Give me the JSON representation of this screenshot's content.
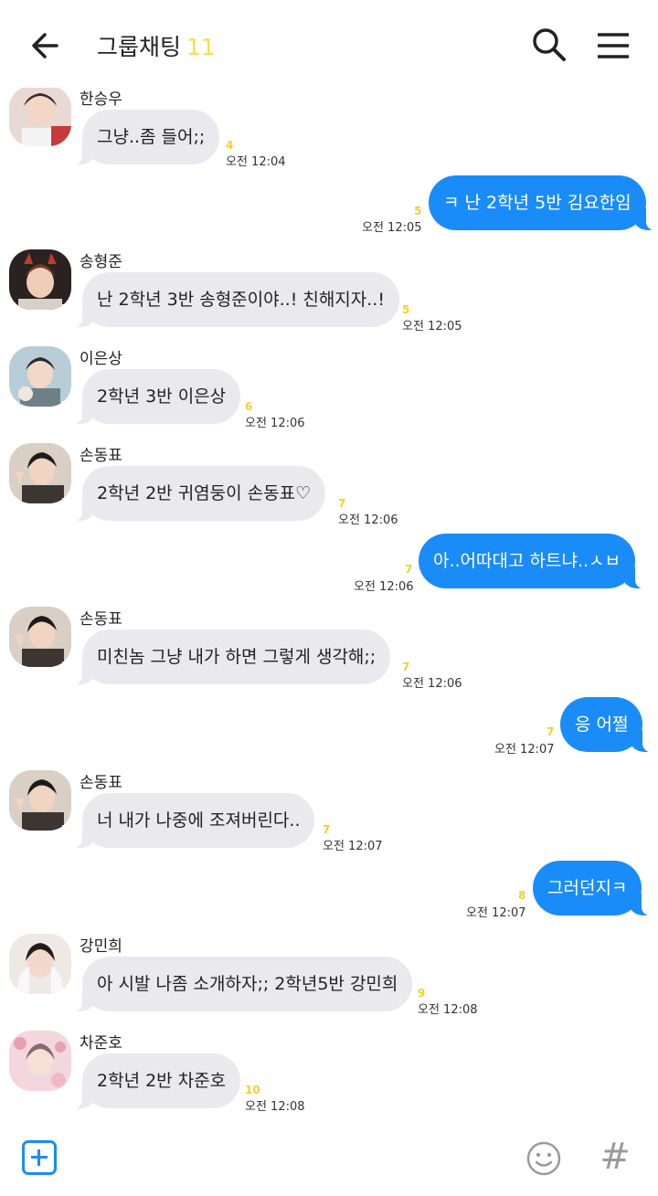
{
  "header": {
    "title": "그룹채팅",
    "member_count": "11",
    "back_icon": "back-arrow-icon",
    "search_icon": "search-icon",
    "menu_icon": "hamburger-menu-icon"
  },
  "messages": [
    {
      "sender": "한승우",
      "text": "그냥..좀 들어;;",
      "unread": "4",
      "time": "오전 12:04"
    },
    {
      "text": "ㅋ 난 2학년 5반 김요한임",
      "unread": "5",
      "time": "오전 12:05"
    },
    {
      "sender": "송형준",
      "text": "난 2학년 3반 송형준이야..! 친해지자..!",
      "unread": "5",
      "time": "오전 12:05"
    },
    {
      "sender": "이은상",
      "text": "2학년 3반 이은상",
      "unread": "6",
      "time": "오전 12:06"
    },
    {
      "sender": "손동표",
      "text": "2학년 2반 귀염둥이 손동표♡",
      "unread": "7",
      "time": "오전 12:06"
    },
    {
      "text": "아..어따대고 하트냐..ㅅㅂ",
      "unread": "7",
      "time": "오전 12:06"
    },
    {
      "sender": "손동표",
      "text": "미친놈  그냥 내가 하면 그렇게 생각해;;",
      "unread": "7",
      "time": "오전 12:06"
    },
    {
      "text": "응 어쩔",
      "unread": "7",
      "time": "오전 12:07"
    },
    {
      "sender": "손동표",
      "text": "너 내가 나중에 조져버린다..",
      "unread": "7",
      "time": "오전 12:07"
    },
    {
      "text": "그러던지ㅋ",
      "unread": "8",
      "time": "오전 12:07"
    },
    {
      "sender": "강민희",
      "text": "아 시발 나좀 소개하자;; 2학년5반 강민희",
      "unread": "9",
      "time": "오전 12:08"
    },
    {
      "sender": "차준호",
      "text": "2학년 2반 차준호",
      "unread": "10",
      "time": "오전 12:08"
    }
  ],
  "bottom": {
    "add_icon": "plus-square-icon",
    "emoji_icon": "smiley-icon",
    "hash_icon": "hashtag-icon",
    "hash_glyph": "#"
  },
  "colors": {
    "outgoing_bubble": "#1a8cf7",
    "incoming_bubble": "#e9e9ee",
    "unread_count": "#f2d02a",
    "title_count": "#f6e23c"
  }
}
